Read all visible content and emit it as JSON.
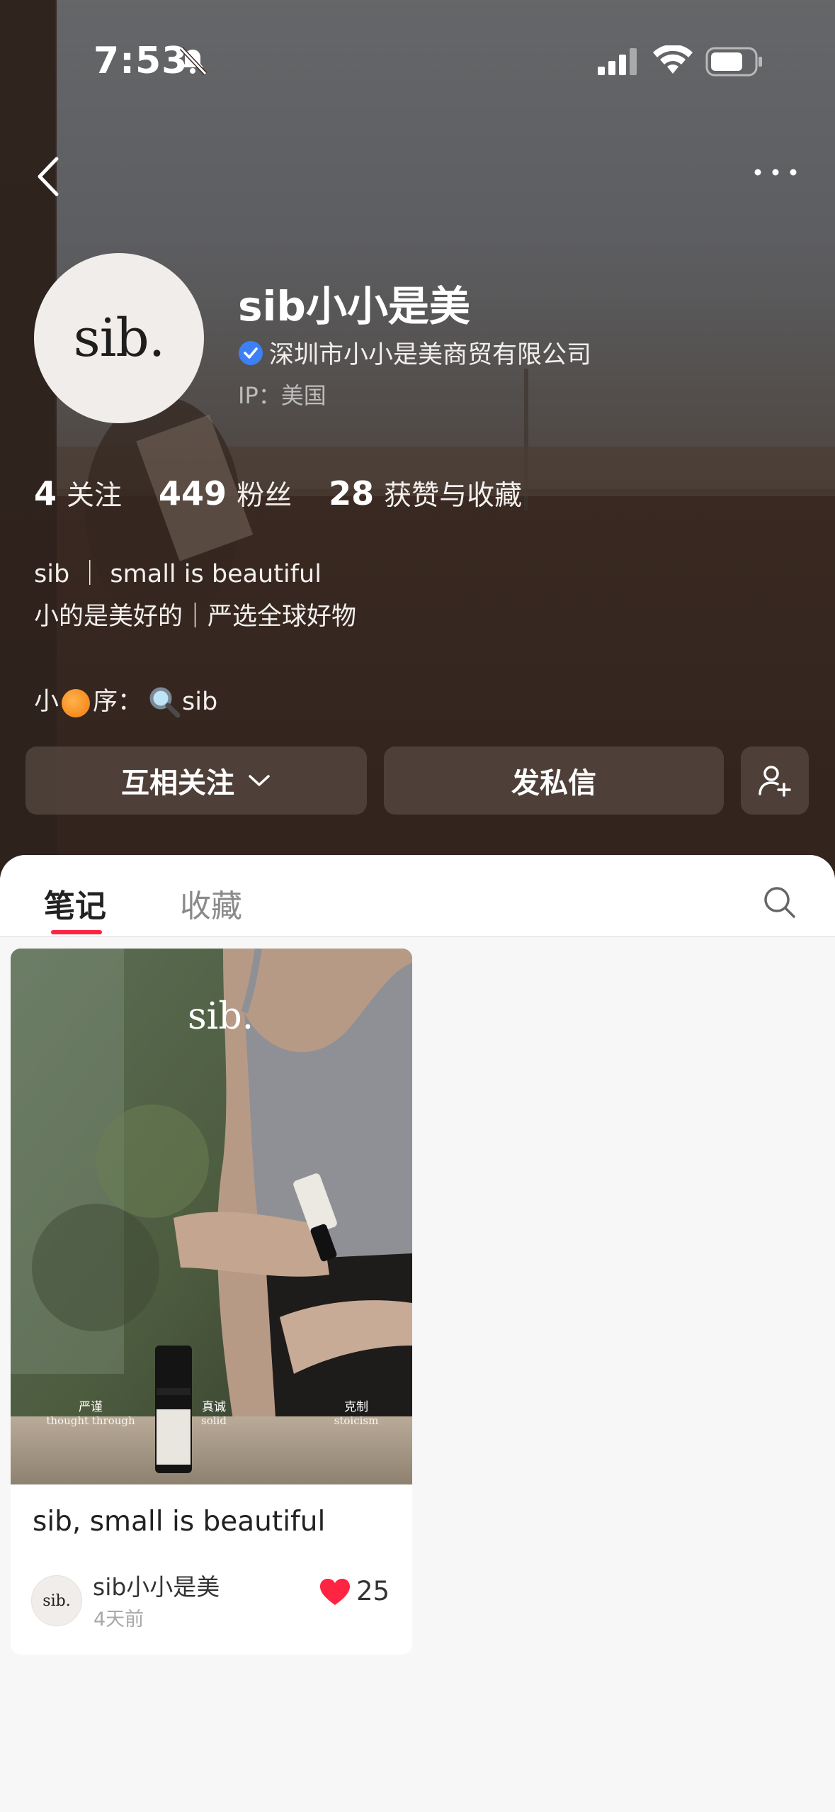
{
  "status_bar": {
    "time": "7:53"
  },
  "profile": {
    "avatar_text": "sib.",
    "name": "sib小小是美",
    "verified_company": "深圳市小小是美商贸有限公司",
    "ip_location": "IP：美国"
  },
  "stats": [
    {
      "count": "4",
      "label": "关注"
    },
    {
      "count": "449",
      "label": "粉丝"
    },
    {
      "count": "28",
      "label": "获赞与收藏"
    }
  ],
  "bio": {
    "line1": "sib ｜ small is beautiful",
    "line2": "小的是美好的｜严选全球好物",
    "line3_prefix": "小",
    "line3_mid": "序：",
    "line3_suffix": "sib"
  },
  "actions": {
    "follow_label": "互相关注",
    "message_label": "发私信"
  },
  "tabs": [
    {
      "label": "笔记",
      "active": true
    },
    {
      "label": "收藏",
      "active": false
    }
  ],
  "notes": [
    {
      "cover_brand": "sib.",
      "cover_words": [
        {
          "zh": "严谨",
          "en": "thought through"
        },
        {
          "zh": "真诚",
          "en": "solid"
        },
        {
          "zh": "克制",
          "en": "stoicism"
        }
      ],
      "title": "sib, small is beautiful",
      "author_avatar_text": "sib.",
      "author": "sib小小是美",
      "time_ago": "4天前",
      "likes": "25"
    }
  ],
  "colors": {
    "accent": "#ff2442",
    "verified": "#3d7ff5",
    "header_bg": "#3b2a22"
  },
  "icons": [
    "back-icon",
    "more-icon",
    "verified-icon",
    "chevron-down-icon",
    "add-user-icon",
    "search-icon",
    "heart-icon",
    "orange-emoji-icon",
    "magnifier-emoji-icon"
  ]
}
